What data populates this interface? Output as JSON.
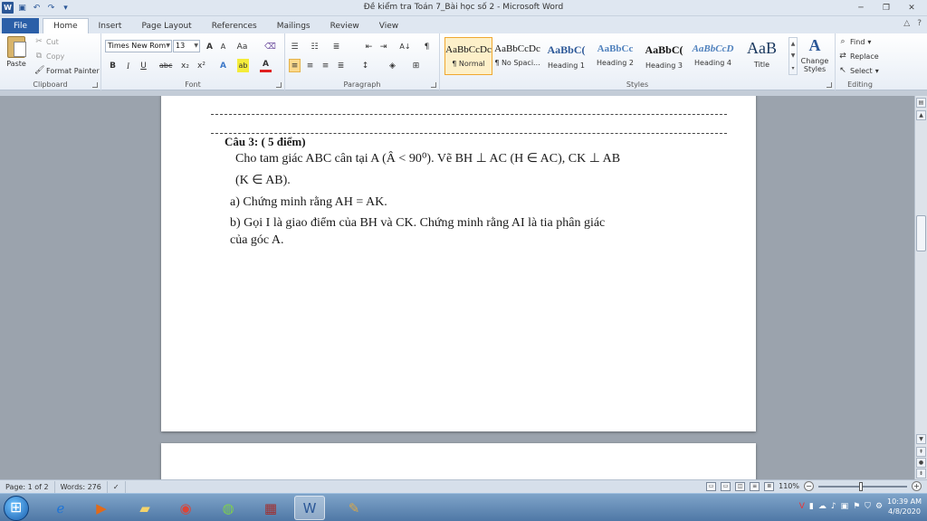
{
  "window": {
    "title": "Đề kiểm tra Toán 7_Bài học số 2  -  Microsoft Word",
    "app_icon": "W",
    "controls": [
      "─",
      "❐",
      "✕"
    ]
  },
  "tabs": [
    "File",
    "Home",
    "Insert",
    "Page Layout",
    "References",
    "Mailings",
    "Review",
    "View"
  ],
  "active_tab": "Home",
  "clipboard": {
    "paste": "Paste",
    "cut": "Cut",
    "copy": "Copy",
    "format_painter": "Format Painter",
    "label": "Clipboard"
  },
  "font": {
    "family": "Times New Rom",
    "size": "13",
    "label": "Font",
    "grow": "A",
    "shrink": "A",
    "change_case": "Aa",
    "bold": "B",
    "italic": "I",
    "underline": "U",
    "strikethrough": "abc",
    "subscript": "x₂",
    "superscript": "x²",
    "effects": "A",
    "highlight": "ab",
    "color": "A"
  },
  "paragraph": {
    "label": "Paragraph",
    "show_marks": "¶",
    "sort": "A↓"
  },
  "styles": {
    "label": "Styles",
    "items": [
      {
        "sample": "AaBbCcDc",
        "name": "¶ Normal"
      },
      {
        "sample": "AaBbCcDc",
        "name": "¶ No Spaci..."
      },
      {
        "sample": "AaBbC(",
        "name": "Heading 1"
      },
      {
        "sample": "AaBbCc",
        "name": "Heading 2"
      },
      {
        "sample": "AaBbC(",
        "name": "Heading 3"
      },
      {
        "sample": "AaBbCcD",
        "name": "Heading 4"
      },
      {
        "sample": "AaB",
        "name": "Title"
      }
    ],
    "change_styles": "Change Styles"
  },
  "editing": {
    "label": "Editing",
    "find": "Find",
    "replace": "Replace",
    "select": "Select"
  },
  "document": {
    "question_title": "Câu 3: ( 5 điểm)",
    "line1": "Cho tam giác ABC cân tại A  (Â < 90⁰).  Vẽ BH ⊥ AC (H ∈ AC), CK ⊥ AB",
    "line2": "(K ∈ AB).",
    "line3": "a) Chứng minh rằng AH = AK.",
    "line4": "b) Gọi I là giao điểm của BH và CK. Chứng minh rằng AI là tia phân giác",
    "line5": "của góc A."
  },
  "status": {
    "page": "Page: 1 of 2",
    "words": "Words: 276",
    "zoom": "110%",
    "zoom_level_fraction": 0.48
  },
  "taskbar": {
    "time": "10:39 AM",
    "date": "4/8/2020"
  }
}
